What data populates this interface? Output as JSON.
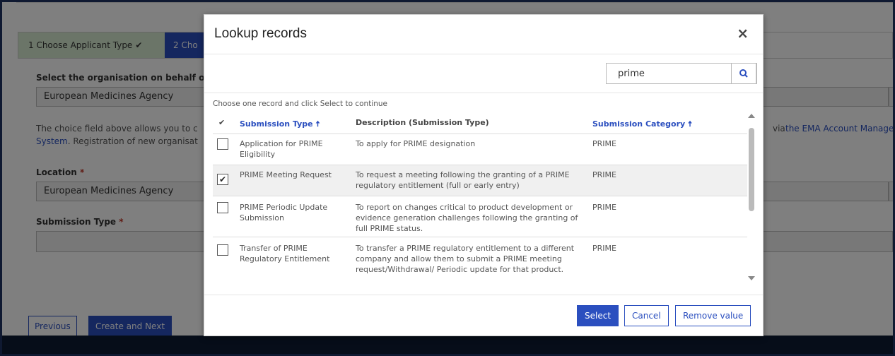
{
  "wizard": {
    "step1_label": "1 Choose Applicant Type",
    "step1_check": "✔",
    "step2_label": "2 Cho"
  },
  "form": {
    "org_label": "Select the organisation on behalf o",
    "org_value": "European Medicines Agency",
    "info_line1": "The choice field above allows you to c",
    "info_line1_right": "via",
    "info_link_right": "the EMA Account Manage",
    "info_link_left": "System",
    "info_line2": ". Registration of new organisat",
    "location_label": "Location",
    "location_value": "European Medicines Agency",
    "submission_type_label": "Submission Type",
    "required_mark": "*",
    "previous_button": "Previous",
    "create_next_button": "Create and Next"
  },
  "modal": {
    "title": "Lookup records",
    "close": "×",
    "search_value": "prime",
    "hint": "Choose one record and click Select to continue",
    "columns": {
      "check": "✔",
      "type": "Submission Type",
      "type_sort": "🠅",
      "description": "Description (Submission Type)",
      "category": "Submission Category",
      "category_sort": "🠅"
    },
    "rows": [
      {
        "selected": false,
        "check": "",
        "type": [
          "Application for PRIME",
          "Eligibility"
        ],
        "description": [
          "To apply for PRIME designation"
        ],
        "category": "PRIME"
      },
      {
        "selected": true,
        "check": "✔",
        "type": [
          "PRIME Meeting Request"
        ],
        "description": [
          "To request a meeting following the granting of a PRIME",
          "regulatory entitlement (full or early entry)"
        ],
        "category": "PRIME"
      },
      {
        "selected": false,
        "check": "",
        "type": [
          "PRIME Periodic Update",
          "Submission"
        ],
        "description": [
          "To report on changes critical to product development or",
          "evidence generation challenges following the granting of",
          "full PRIME status."
        ],
        "category": "PRIME"
      },
      {
        "selected": false,
        "check": "",
        "type": [
          "Transfer of PRIME",
          "Regulatory Entitlement"
        ],
        "description": [
          "To transfer a PRIME regulatory entitlement to a different",
          "company and allow them to submit a PRIME meeting",
          "request/Withdrawal/ Periodic update for that product."
        ],
        "category": "PRIME"
      }
    ],
    "buttons": {
      "select": "Select",
      "cancel": "Cancel",
      "remove": "Remove value"
    }
  },
  "colors": {
    "accent": "#2b4fbf",
    "step_done_bg": "#d6ead0",
    "frame": "#1f3262"
  }
}
